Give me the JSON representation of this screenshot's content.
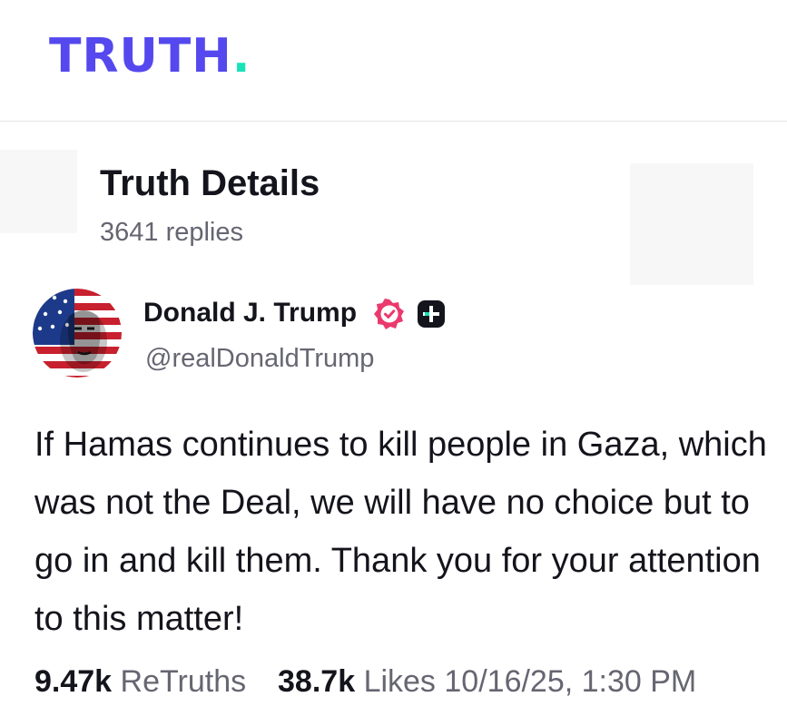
{
  "brand": {
    "logo_text": "TRUTH",
    "logo_dot": ".",
    "primary_color": "#5448ee",
    "accent_color": "#17e2b8"
  },
  "header": {
    "title": "Truth Details",
    "replies": "3641 replies"
  },
  "author": {
    "name": "Donald J. Trump",
    "handle": "@realDonaldTrump",
    "verified_icon": "verified-badge-icon",
    "plus_icon": "plus-badge-icon"
  },
  "post": {
    "text": "If Hamas continues to kill people in Gaza, which was not the Deal, we will have no choice but to go in and kill them. Thank you for your attention to this matter!"
  },
  "stats": {
    "retruths_count": "9.47k",
    "retruths_label": "ReTruths",
    "likes_count": "38.7k",
    "likes_label": "Likes",
    "timestamp": "10/16/25, 1:30 PM"
  }
}
